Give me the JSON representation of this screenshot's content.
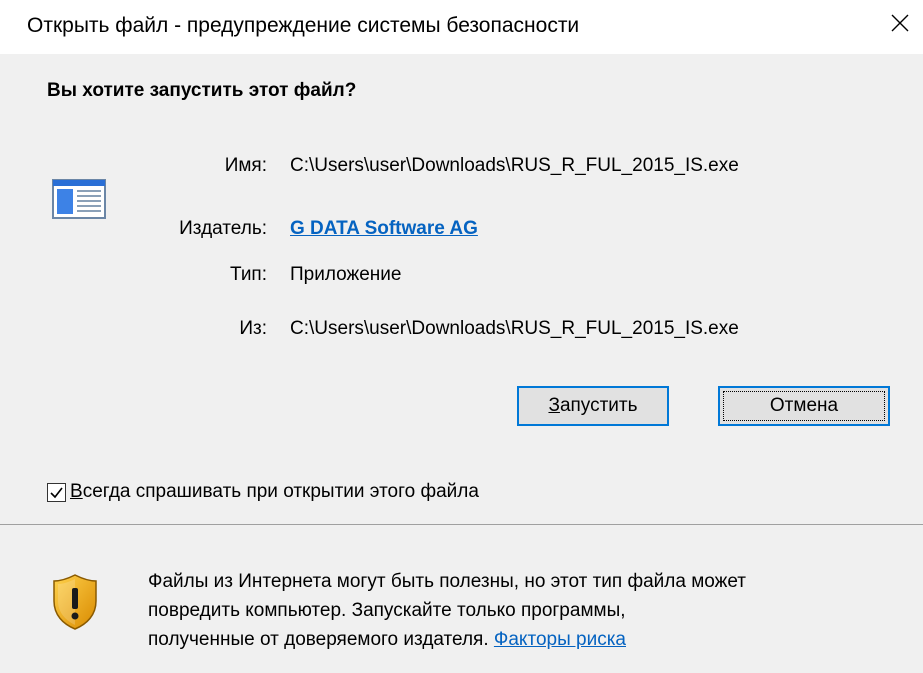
{
  "window": {
    "title": "Открыть файл - предупреждение системы безопасности"
  },
  "dialog": {
    "question": "Вы хотите запустить этот файл?",
    "fields": {
      "name_label": "Имя:",
      "name_value": "C:\\Users\\user\\Downloads\\RUS_R_FUL_2015_IS.exe",
      "publisher_label": "Издатель:",
      "publisher_value": "G DATA Software AG",
      "type_label": "Тип:",
      "type_value": "Приложение",
      "from_label": "Из:",
      "from_value": "C:\\Users\\user\\Downloads\\RUS_R_FUL_2015_IS.exe"
    },
    "buttons": {
      "run_mnemonic": "З",
      "run_rest": "апустить",
      "cancel": "Отмена"
    },
    "checkbox": {
      "checked": true,
      "mnemonic": "В",
      "label_rest": "сегда спрашивать при открытии этого файла"
    },
    "warning": {
      "line1": "Файлы из Интернета могут быть полезны, но этот тип файла может",
      "line2": "повредить компьютер. Запускайте только программы,",
      "line3": "полученные от доверяемого издателя.",
      "link": "Факторы риска"
    }
  },
  "icons": {
    "close": "close-icon",
    "file": "application-file-icon",
    "shield": "security-shield-icon",
    "check": "checkmark-icon"
  },
  "colors": {
    "link": "#0563c1",
    "focus_border": "#0078d7",
    "panel_bg": "#f0f0f0",
    "shield_gold": "#e8a317"
  }
}
